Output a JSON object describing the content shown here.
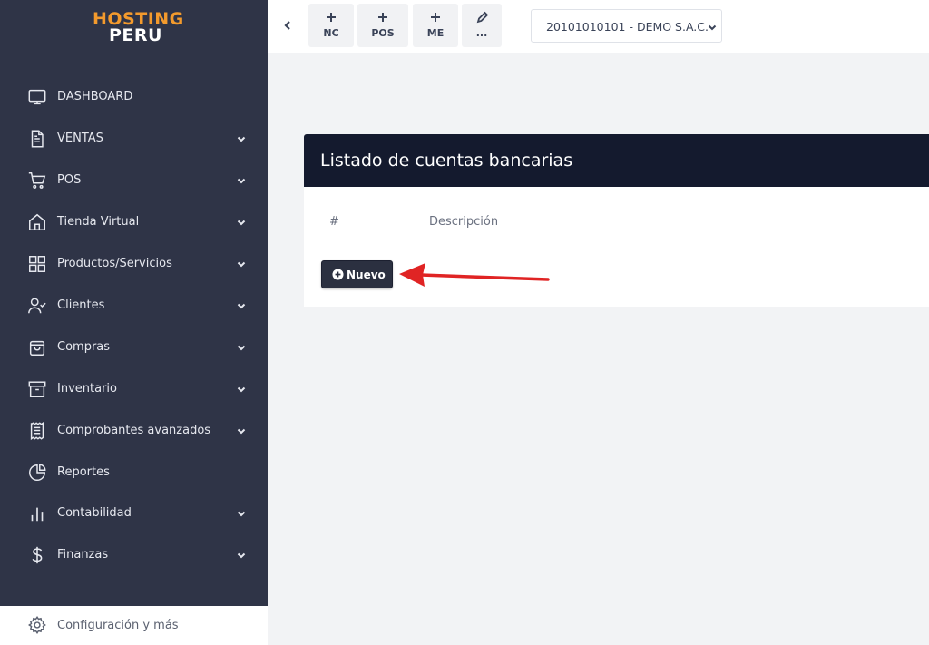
{
  "logo": {
    "line1": "HOSTING",
    "line2": "PERU"
  },
  "sidebar": {
    "items": [
      {
        "label": "DASHBOARD",
        "icon": "monitor-icon",
        "has_submenu": false
      },
      {
        "label": "VENTAS",
        "icon": "document-icon",
        "has_submenu": true
      },
      {
        "label": "POS",
        "icon": "cart-icon",
        "has_submenu": true
      },
      {
        "label": "Tienda Virtual",
        "icon": "home-icon",
        "has_submenu": true
      },
      {
        "label": "Productos/Servicios",
        "icon": "grid-icon",
        "has_submenu": true
      },
      {
        "label": "Clientes",
        "icon": "user-check-icon",
        "has_submenu": true
      },
      {
        "label": "Compras",
        "icon": "shopping-bag-icon",
        "has_submenu": true
      },
      {
        "label": "Inventario",
        "icon": "archive-icon",
        "has_submenu": true
      },
      {
        "label": "Comprobantes avanzados",
        "icon": "receipt-icon",
        "has_submenu": true
      },
      {
        "label": "Reportes",
        "icon": "pie-chart-icon",
        "has_submenu": false
      },
      {
        "label": "Contabilidad",
        "icon": "bar-chart-icon",
        "has_submenu": true
      },
      {
        "label": "Finanzas",
        "icon": "dollar-icon",
        "has_submenu": true
      }
    ],
    "config_label": "Configuración y más"
  },
  "topbar": {
    "quick_buttons": [
      {
        "label": "NC",
        "icon": "plus-icon"
      },
      {
        "label": "POS",
        "icon": "plus-icon"
      },
      {
        "label": "ME",
        "icon": "plus-icon"
      },
      {
        "label": "...",
        "icon": "pencil-icon"
      }
    ],
    "company_selected": "20101010101 - DEMO S.A.C."
  },
  "card": {
    "title": "Listado de cuentas bancarias",
    "columns": [
      "#",
      "Descripción"
    ],
    "new_button": "Nuevo"
  },
  "colors": {
    "sidebar_bg": "#2f3447",
    "card_header_bg": "#141a2e",
    "logo_accent": "#f39a2d",
    "arrow": "#e02424"
  }
}
